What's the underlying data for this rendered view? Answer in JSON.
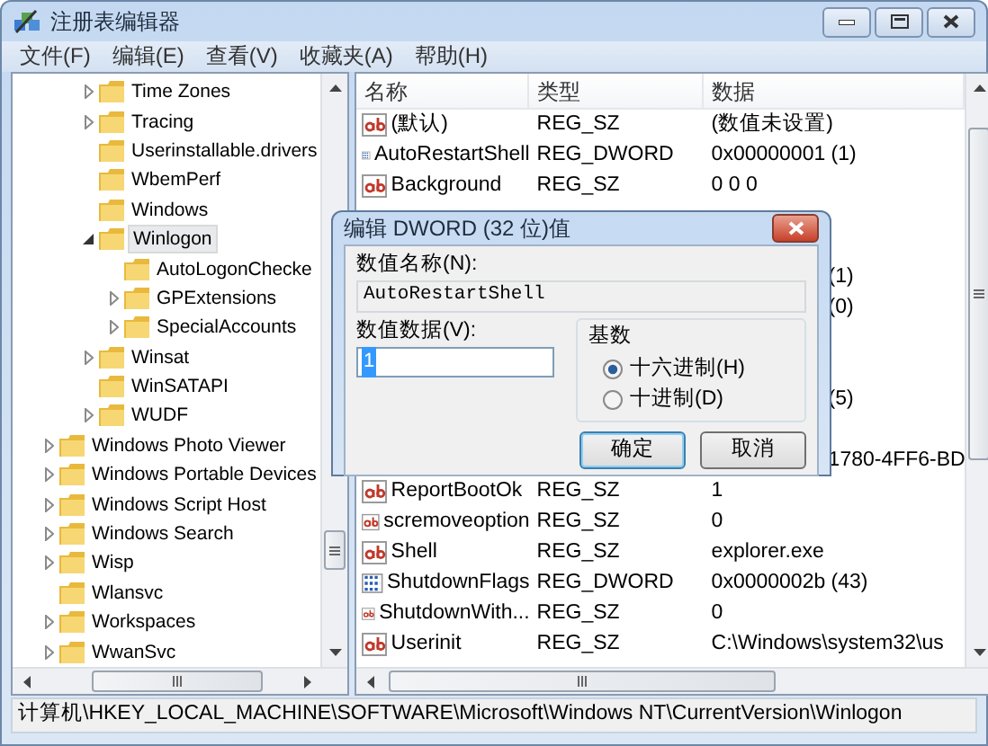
{
  "window": {
    "title": "注册表编辑器"
  },
  "menu": [
    "文件(F)",
    "编辑(E)",
    "查看(V)",
    "收藏夹(A)",
    "帮助(H)"
  ],
  "tree": {
    "items_under_hidden_parent": [
      {
        "label": "Time Zones",
        "expanded": false,
        "selected": false
      },
      {
        "label": "Tracing",
        "expanded": false,
        "selected": false
      },
      {
        "label": "Userinstallable.drivers",
        "selected": false
      },
      {
        "label": "WbemPerf",
        "selected": false
      },
      {
        "label": "Windows",
        "selected": false
      },
      {
        "label": "Winlogon",
        "expanded": true,
        "selected": true,
        "children": [
          {
            "label": "AutoLogonChecke",
            "selected": false
          },
          {
            "label": "GPExtensions",
            "expanded": false,
            "selected": false
          },
          {
            "label": "SpecialAccounts",
            "expanded": false,
            "selected": false
          }
        ]
      },
      {
        "label": "Winsat",
        "expanded": false,
        "selected": false
      },
      {
        "label": "WinSATAPI",
        "selected": false
      },
      {
        "label": "WUDF",
        "expanded": false,
        "selected": false
      }
    ],
    "items": [
      {
        "label": "Windows Photo Viewer",
        "expanded": false,
        "selected": false
      },
      {
        "label": "Windows Portable Devices",
        "expanded": false,
        "selected": false
      },
      {
        "label": "Windows Script Host",
        "expanded": false,
        "selected": false
      },
      {
        "label": "Windows Search",
        "expanded": false,
        "selected": false
      },
      {
        "label": "Wisp",
        "expanded": false,
        "selected": false
      },
      {
        "label": "Wlansvc",
        "selected": false
      },
      {
        "label": "Workspaces",
        "expanded": false,
        "selected": false
      },
      {
        "label": "WwanSvc",
        "expanded": false,
        "selected": false
      }
    ]
  },
  "values": {
    "columns": [
      "名称",
      "类型",
      "数据"
    ],
    "rows": [
      {
        "kind": "string",
        "name": "(默认)",
        "type": "REG_SZ",
        "data": "(数值未设置)"
      },
      {
        "kind": "dword",
        "name": "AutoRestartShell",
        "type": "REG_DWORD",
        "data": "0x00000001 (1)"
      },
      {
        "kind": "string",
        "name": "Background",
        "type": "REG_SZ",
        "data": "0 0 0"
      },
      {
        "kind": "covered"
      },
      {
        "kind": "covered"
      },
      {
        "kind": "covered",
        "data": "(1)"
      },
      {
        "kind": "covered",
        "data": "(0)"
      },
      {
        "kind": "covered"
      },
      {
        "kind": "covered"
      },
      {
        "kind": "covered",
        "data": "(5)"
      },
      {
        "kind": "covered"
      },
      {
        "kind": "covered",
        "data": "1780-4FF6-BD"
      },
      {
        "kind": "string",
        "name": "ReportBootOk",
        "type": "REG_SZ",
        "data": "1"
      },
      {
        "kind": "string",
        "name": "scremoveoption",
        "type": "REG_SZ",
        "data": "0"
      },
      {
        "kind": "string",
        "name": "Shell",
        "type": "REG_SZ",
        "data": "explorer.exe"
      },
      {
        "kind": "dword",
        "name": "ShutdownFlags",
        "type": "REG_DWORD",
        "data": "0x0000002b (43)"
      },
      {
        "kind": "string",
        "name": "ShutdownWith...",
        "type": "REG_SZ",
        "data": "0"
      },
      {
        "kind": "string",
        "name": "Userinit",
        "type": "REG_SZ",
        "data": "C:\\Windows\\system32\\us"
      }
    ]
  },
  "status_bar": "计算机\\HKEY_LOCAL_MACHINE\\SOFTWARE\\Microsoft\\Windows NT\\CurrentVersion\\Winlogon",
  "dialog": {
    "title": "编辑 DWORD (32 位)值",
    "name_label": "数值名称(N):",
    "name_value": "AutoRestartShell",
    "data_label": "数值数据(V):",
    "data_value": "1",
    "data_text_selected": true,
    "base_label": "基数",
    "bases": [
      {
        "label": "十六进制(H)",
        "selected": true
      },
      {
        "label": "十进制(D)",
        "selected": false
      }
    ],
    "buttons": [
      "确定",
      "取消"
    ]
  }
}
